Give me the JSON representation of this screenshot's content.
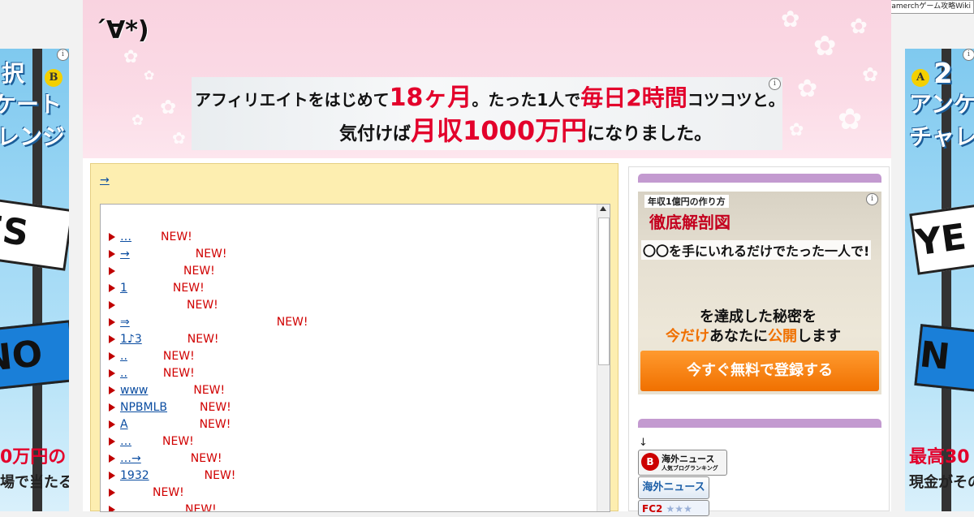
{
  "site": {
    "title": "´∀*)"
  },
  "gamerch": {
    "label": "Gamerchゲーム攻略Wiki"
  },
  "header_ad": {
    "line1_a": "アフィリエイトをはじめて",
    "line1_b": "18ヶ月",
    "line1_c": "。たった1人で",
    "line1_d": "毎日2時間",
    "line1_e": "コツコツと。",
    "line2_a": "気付けば",
    "line2_b": "月収1000万円",
    "line2_c": "になりました。",
    "info": "i"
  },
  "left_ad": {
    "headline1": "択",
    "headline2": "ケート",
    "headline3": "レンジ",
    "badge": "B",
    "sign_yes": "ES",
    "sign_no": "NO",
    "foot1": "0万円の",
    "foot2": "場で当たる!",
    "info": "i"
  },
  "right_ad": {
    "headline1": "2",
    "headline2": "アンケ",
    "headline3": "チャレ",
    "badge": "A",
    "sign_yes": "YE",
    "sign_no": "N",
    "foot1": "最高30",
    "foot2": "現金がその場",
    "info": "i"
  },
  "main": {
    "top_link": "→",
    "items": [
      {
        "label": "…",
        "new": "NEW!"
      },
      {
        "label": "→",
        "new": "NEW!"
      },
      {
        "label": "",
        "new": "NEW!"
      },
      {
        "label": "1",
        "new": "NEW!"
      },
      {
        "label": "",
        "new": "NEW!"
      },
      {
        "label": "⇒",
        "new": "NEW!"
      },
      {
        "label": "1♪3",
        "new": "NEW!"
      },
      {
        "label": "..",
        "new": "NEW!"
      },
      {
        "label": "..",
        "new": "NEW!"
      },
      {
        "label": "www",
        "new": "NEW!"
      },
      {
        "label": "NPBMLB",
        "new": "NEW!"
      },
      {
        "label": "A",
        "new": "NEW!"
      },
      {
        "label": "…",
        "new": "NEW!"
      },
      {
        "label": "…→",
        "new": "NEW!"
      },
      {
        "label": "1932",
        "new": "NEW!"
      },
      {
        "label": "",
        "new": "NEW!"
      },
      {
        "label": "…",
        "new": "NEW!"
      }
    ]
  },
  "sidebar": {
    "ad": {
      "tag": "年収1億円の作り方",
      "title": "徹底解剖図",
      "line1": "〇〇を手にいれるだけでたった一人で!",
      "line2": "を達成した秘密を",
      "line3_a": "今だけ",
      "line3_b": "あなたに",
      "line3_c": "公開",
      "line3_d": "します",
      "cta": "今すぐ無料で登録する",
      "info": "i"
    },
    "arrow": "↓",
    "rank1_main": "海外ニュース",
    "rank1_sub": "人気ブログランキング",
    "rank2": "海外ニュース",
    "rank3": "FC2"
  }
}
